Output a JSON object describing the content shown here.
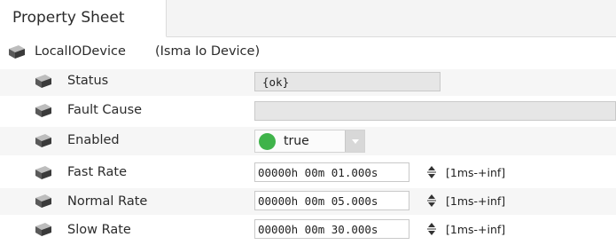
{
  "tab": {
    "label": "Property Sheet"
  },
  "root": {
    "name": "LocalIODevice",
    "type": "(Isma Io Device)"
  },
  "properties": {
    "status": {
      "label": "Status",
      "value": "{ok}"
    },
    "fault_cause": {
      "label": "Fault Cause",
      "value": ""
    },
    "enabled": {
      "label": "Enabled",
      "value": "true",
      "indicator_color": "#3fb34a"
    },
    "fast_rate": {
      "label": "Fast Rate",
      "value": "00000h 00m 01.000s",
      "range": "[1ms-+inf]"
    },
    "normal_rate": {
      "label": "Normal Rate",
      "value": "00000h 00m 05.000s",
      "range": "[1ms-+inf]"
    },
    "slow_rate": {
      "label": "Slow Rate",
      "value": "00000h 00m 30.000s",
      "range": "[1ms-+inf]"
    }
  },
  "icons": {
    "component": "component-icon",
    "spinner": "spinner-icon",
    "dropdown": "chevron-down-icon"
  }
}
